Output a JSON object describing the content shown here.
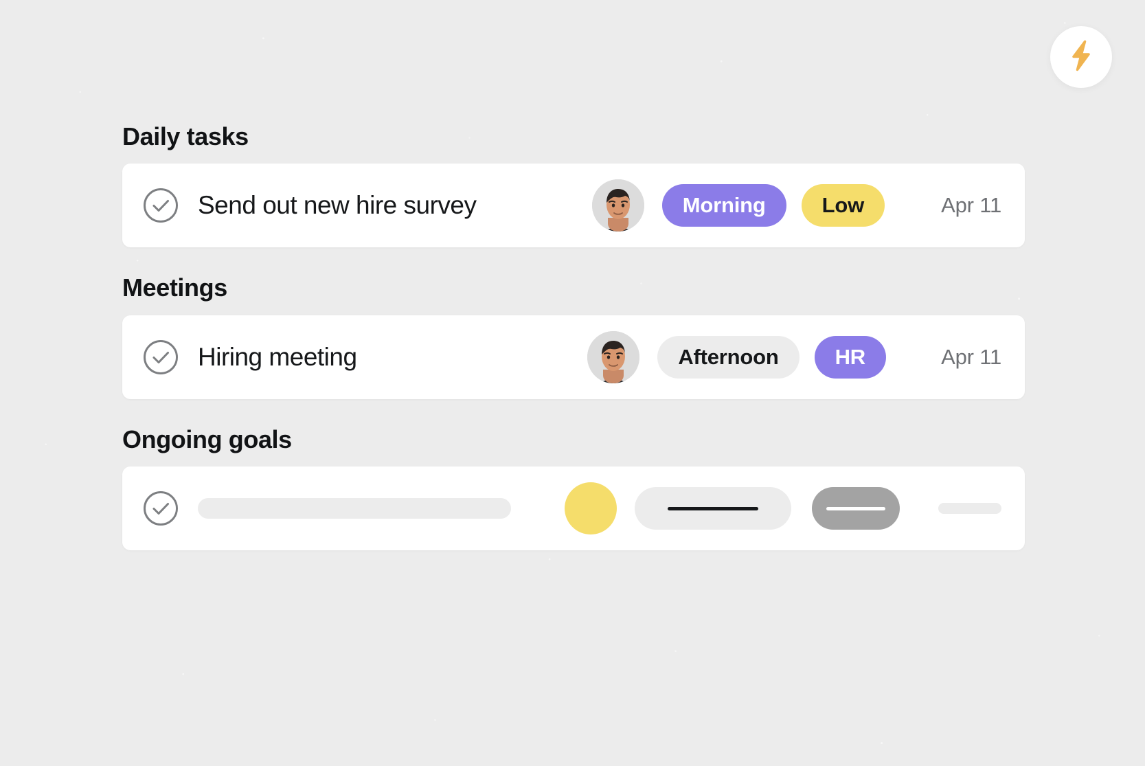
{
  "background_color": "#ececec",
  "fab": {
    "icon": "lightning-bolt-icon",
    "icon_color": "#f0b450",
    "background": "#ffffff"
  },
  "colors": {
    "accent_purple": "#8b7ce8",
    "accent_yellow": "#f5dd6b",
    "badge_gray": "#ececec",
    "text_primary": "#16181a",
    "text_muted": "#6e7074",
    "card_background": "#ffffff",
    "skeleton_dark": "#a3a3a3"
  },
  "sections": [
    {
      "title": "Daily tasks",
      "row": {
        "checkbox_icon": "check-circle-icon",
        "title": "Send out new hire survey",
        "avatar": "user-avatar",
        "badges": [
          {
            "label": "Morning",
            "style": "purple"
          },
          {
            "label": "Low",
            "style": "yellow"
          }
        ],
        "date": "Apr 11"
      }
    },
    {
      "title": "Meetings",
      "row": {
        "checkbox_icon": "check-circle-icon",
        "title": "Hiring meeting",
        "avatar": "user-avatar",
        "badges": [
          {
            "label": "Afternoon",
            "style": "gray"
          },
          {
            "label": "HR",
            "style": "purple"
          }
        ],
        "date": "Apr 11"
      }
    },
    {
      "title": "Ongoing goals",
      "row": {
        "checkbox_icon": "check-circle-icon",
        "placeholder": true
      }
    }
  ]
}
